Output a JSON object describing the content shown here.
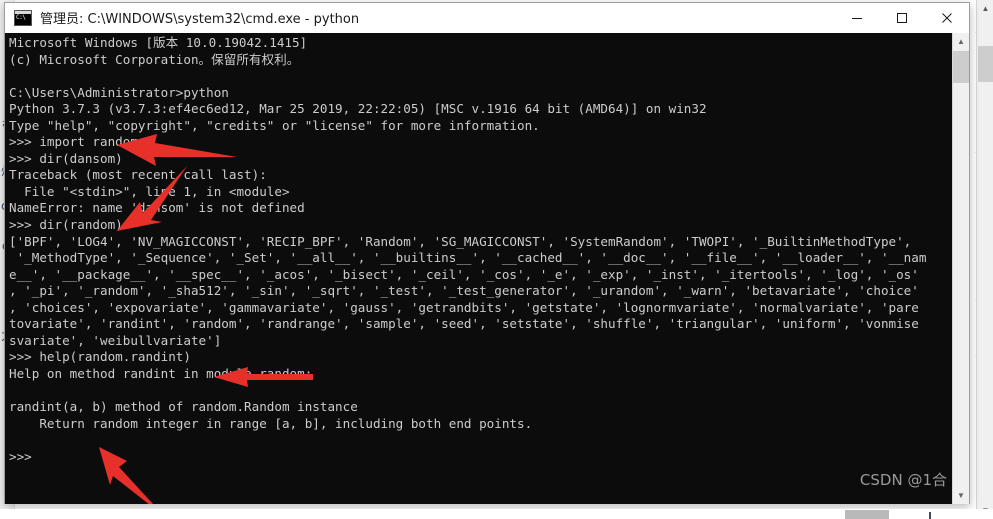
{
  "window": {
    "title": "管理员: C:\\WINDOWS\\system32\\cmd.exe - python",
    "icon": "cmd-console-icon",
    "buttons": {
      "minimize": "minimize-button",
      "maximize": "maximize-button",
      "close": "close-button"
    },
    "background_color": "#0c0c0c",
    "text_color": "#cccccc"
  },
  "console": {
    "lines": [
      "Microsoft Windows [版本 10.0.19042.1415]",
      "(c) Microsoft Corporation。保留所有权利。",
      "",
      "C:\\Users\\Administrator>python",
      "Python 3.7.3 (v3.7.3:ef4ec6ed12, Mar 25 2019, 22:22:05) [MSC v.1916 64 bit (AMD64)] on win32",
      "Type \"help\", \"copyright\", \"credits\" or \"license\" for more information.",
      ">>> import random",
      ">>> dir(dansom)",
      "Traceback (most recent call last):",
      "  File \"<stdin>\", line 1, in <module>",
      "NameError: name 'dansom' is not defined",
      ">>> dir(random)",
      "['BPF', 'LOG4', 'NV_MAGICCONST', 'RECIP_BPF', 'Random', 'SG_MAGICCONST', 'SystemRandom', 'TWOPI', '_BuiltinMethodType',",
      " '_MethodType', '_Sequence', '_Set', '__all__', '__builtins__', '__cached__', '__doc__', '__file__', '__loader__', '__nam",
      "e__', '__package__', '__spec__', '_acos', '_bisect', '_ceil', '_cos', '_e', '_exp', '_inst', '_itertools', '_log', '_os'",
      ", '_pi', '_random', '_sha512', '_sin', '_sqrt', '_test', '_test_generator', '_urandom', '_warn', 'betavariate', 'choice'",
      ", 'choices', 'expovariate', 'gammavariate', 'gauss', 'getrandbits', 'getstate', 'lognormvariate', 'normalvariate', 'pare",
      "tovariate', 'randint', 'random', 'randrange', 'sample', 'seed', 'setstate', 'shuffle', 'triangular', 'uniform', 'vonmise",
      "svariate', 'weibullvariate']",
      ">>> help(random.randint)",
      "Help on method randint in module random:",
      "",
      "randint(a, b) method of random.Random instance",
      "    Return random integer in range [a, b], including both end points.",
      "",
      ">>>"
    ]
  },
  "annotations": {
    "arrow_color": "#e8302a",
    "arrows": [
      {
        "name": "arrow-to-import-random",
        "points_at": ">>> import random"
      },
      {
        "name": "arrow-to-dir-random",
        "points_at": ">>> dir(random)"
      },
      {
        "name": "arrow-to-help-randint",
        "points_at": ">>> help(random.randint)"
      },
      {
        "name": "arrow-to-return-description",
        "points_at": "Return random integer in range [a, b], including both end points."
      }
    ]
  },
  "watermark": {
    "text": "CSDN @1合"
  },
  "scrollbars": {
    "console": {
      "up": "▲",
      "down": "▼"
    },
    "page": {
      "up": "▲",
      "down": "▼"
    }
  }
}
